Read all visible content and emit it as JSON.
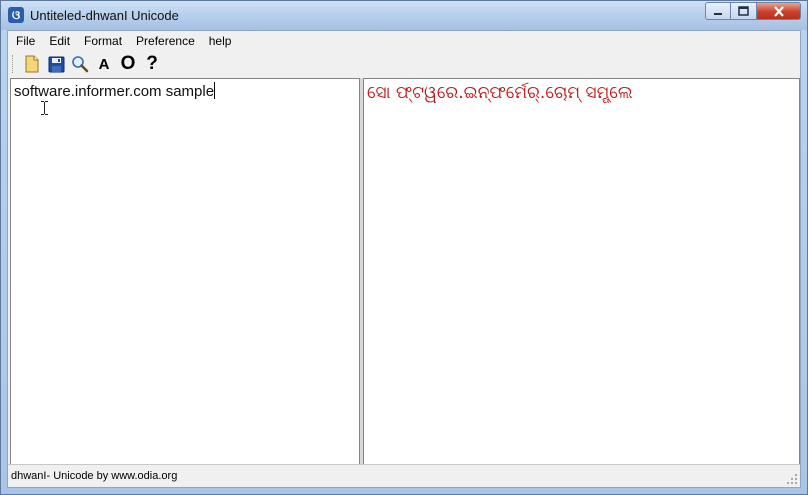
{
  "window": {
    "title": "Untiteled-dhwanI Unicode",
    "icon": "app-logo-icon",
    "controls": {
      "minimize": "minimize-icon",
      "maximize": "maximize-icon",
      "close": "close-icon"
    }
  },
  "menubar": {
    "items": [
      "File",
      "Edit",
      "Format",
      "Preference",
      "help"
    ]
  },
  "toolbar": {
    "buttons": [
      {
        "icon": "open-file-icon"
      },
      {
        "icon": "save-icon"
      },
      {
        "icon": "search-icon"
      },
      {
        "label": "A"
      },
      {
        "label": "O"
      },
      {
        "label": "?"
      }
    ]
  },
  "editor": {
    "input_text": "software.informer.com sample",
    "output_text": "ସୋ  ଫ୍ଟୱରେ.ଇନ୍ଫର୍ମେର୍.ଚୋମ୍     ସମ୍ପ୍ଲେ"
  },
  "status": {
    "text": "dhwanI- Unicode  by www.odia.org"
  },
  "colors": {
    "output_text": "#c01818",
    "title_bar": "#b7cfec",
    "close_button": "#c9402a"
  }
}
